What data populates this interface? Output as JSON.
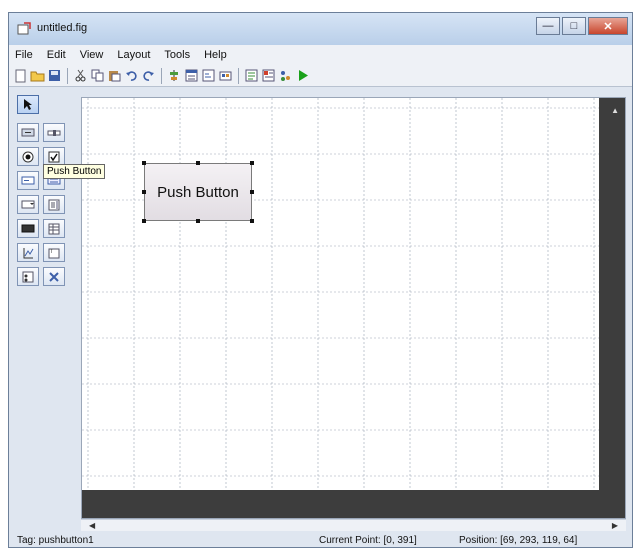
{
  "window": {
    "title": "untitled.fig",
    "controls": {
      "minimize": "—",
      "maximize": "□",
      "close": "✕"
    }
  },
  "menu": [
    "File",
    "Edit",
    "View",
    "Layout",
    "Tools",
    "Help"
  ],
  "toolbar": {
    "icons": [
      "new-file-icon",
      "open-folder-icon",
      "save-icon",
      "cut-icon",
      "copy-icon",
      "paste-icon",
      "undo-icon",
      "redo-icon",
      "align-objects-icon",
      "menu-editor-icon",
      "tab-order-editor-icon",
      "toolbar-editor-icon",
      "m-file-editor-icon",
      "property-inspector-icon",
      "object-browser-icon",
      "run-figure-icon"
    ]
  },
  "palette": {
    "tooltip": "Push Button",
    "items": [
      "select-arrow",
      "push-button",
      "slider",
      "radio-button",
      "check-box",
      "edit-text",
      "static-text",
      "popup-menu",
      "listbox",
      "toggle-button",
      "table",
      "axes",
      "panel",
      "button-group",
      "activex-control"
    ]
  },
  "canvas": {
    "pushbutton_label": "Push Button"
  },
  "status": {
    "tag": "Tag: pushbutton1",
    "current_point": "Current Point:  [0, 391]",
    "position": "Position: [69, 293, 119, 64]"
  },
  "colors": {
    "title_gradient_top": "#d6e4f5",
    "close_button": "#c8452c",
    "run_green": "#1aa11a",
    "dark_margin": "#3d3d3d"
  }
}
